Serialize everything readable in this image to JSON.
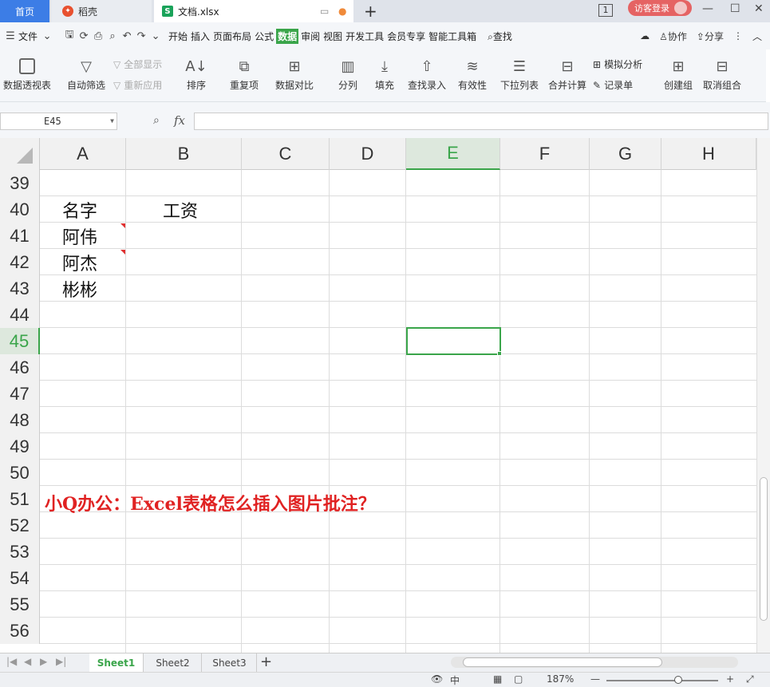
{
  "tabs": {
    "home": "首页",
    "daoke": "稻壳",
    "doc": "文档.xlsx"
  },
  "titlebar": {
    "page_count": "1",
    "guest_login": "访客登录"
  },
  "menu": {
    "file": "文件",
    "items": [
      "开始",
      "插入",
      "页面布局",
      "公式",
      "数据",
      "审阅",
      "视图",
      "开发工具",
      "会员专享",
      "智能工具箱"
    ],
    "active_item": "数据",
    "search": "查找",
    "collab": "协作",
    "share": "分享"
  },
  "ribbon": {
    "pivot": "数据透视表",
    "auto_filter": "自动筛选",
    "show_all": "全部显示",
    "reapply": "重新应用",
    "sort": "排序",
    "duplicates": "重复项",
    "compare": "数据对比",
    "split": "分列",
    "fill": "填充",
    "lookup": "查找录入",
    "validity": "有效性",
    "dropdown": "下拉列表",
    "consolidate": "合并计算",
    "what_if": "模拟分析",
    "record_form": "记录单",
    "group": "创建组",
    "ungroup": "取消组合"
  },
  "formula": {
    "cell_ref": "E45",
    "fx": "fx",
    "value": ""
  },
  "grid": {
    "columns": [
      "A",
      "B",
      "C",
      "D",
      "E",
      "F",
      "G",
      "H"
    ],
    "active_column": "E",
    "rows": [
      "39",
      "40",
      "41",
      "42",
      "43",
      "44",
      "45",
      "46",
      "47",
      "48",
      "49",
      "50",
      "51",
      "52",
      "53",
      "54",
      "55",
      "56"
    ],
    "active_row": "45",
    "cells": {
      "A40": "名字",
      "B40": "工资",
      "A41": "阿伟",
      "A42": "阿杰",
      "A43": "彬彬",
      "A51": "小Q办公：Excel表格怎么插入图片批注？"
    }
  },
  "sheets": [
    "Sheet1",
    "Sheet2",
    "Sheet3"
  ],
  "active_sheet": "Sheet1",
  "status": {
    "zoom": "187%"
  },
  "colors": {
    "accent": "#3aa54a",
    "title_red": "#e02222",
    "home_tab": "#3c7de6"
  }
}
